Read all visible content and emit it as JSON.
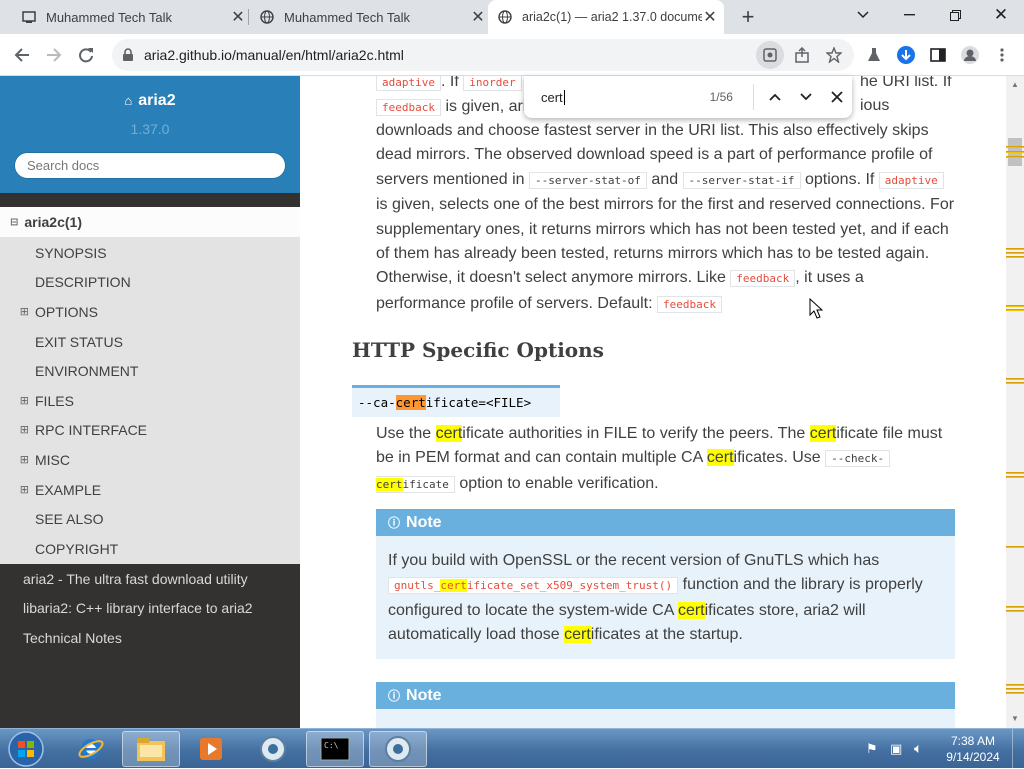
{
  "browser": {
    "tabs": [
      {
        "title": "Muhammed Tech Talk",
        "active": false
      },
      {
        "title": "Muhammed Tech Talk",
        "active": false
      },
      {
        "title": "aria2c(1) — aria2 1.37.0 docume",
        "active": true
      }
    ],
    "new_tab_icon": "plus-icon",
    "url": "aria2.github.io/manual/en/html/aria2c.html"
  },
  "find": {
    "query": "cert",
    "count": "1/56"
  },
  "sidebar": {
    "project": "aria2",
    "version": "1.37.0",
    "search_placeholder": "Search docs",
    "toc_root": "aria2c(1)",
    "items": [
      {
        "label": "SYNOPSIS",
        "toggle": false
      },
      {
        "label": "DESCRIPTION",
        "toggle": false
      },
      {
        "label": "OPTIONS",
        "toggle": true
      },
      {
        "label": "EXIT STATUS",
        "toggle": false
      },
      {
        "label": "ENVIRONMENT",
        "toggle": false
      },
      {
        "label": "FILES",
        "toggle": true
      },
      {
        "label": "RPC INTERFACE",
        "toggle": true
      },
      {
        "label": "MISC",
        "toggle": true
      },
      {
        "label": "EXAMPLE",
        "toggle": true
      },
      {
        "label": "SEE ALSO",
        "toggle": false
      },
      {
        "label": "COPYRIGHT",
        "toggle": false
      }
    ],
    "links": [
      "aria2 - The ultra fast download utility",
      "libaria2: C++ library interface to aria2",
      "Technical Notes"
    ]
  },
  "content": {
    "top_frag": {
      "code_adaptive": "adaptive",
      "t_if": ". If",
      "code_inorder": "inorder",
      "t_tail": "he URI list. If",
      "code_feedback": "feedback",
      "t_given": "is given, ari",
      "t_ious": "ious"
    },
    "para1": {
      "l3": "downloads and choose fastest server in the URI list. This also effectively skips",
      "l4": "dead mirrors. The observed download speed is a part of performance profile of",
      "l5a": "servers mentioned in",
      "code_statof": "--server-stat-of",
      "l5b": "and",
      "code_statif": "--server-stat-if",
      "l5c": "options. If",
      "code_adaptive": "adaptive",
      "l6": "is given, selects one of the best mirrors for the first and reserved connections. For",
      "l7": "supplementary ones, it returns mirrors which has not been tested yet, and if each",
      "l8": "of them has already been tested, returns mirrors which has to be tested again.",
      "l9a": "Otherwise, it doesn't select anymore mirrors. Like",
      "code_feedback": "feedback",
      "l9b": ", it uses a",
      "l10a": "performance profile of servers. Default:",
      "code_default": "feedback"
    },
    "section_title": "HTTP Specific Options",
    "option": {
      "pre": "--ca-",
      "match": "cert",
      "post": "ificate=<FILE>"
    },
    "para2": {
      "a1": "Use the",
      "m1": "cert",
      "a2": "ificate authorities in FILE to verify the peers. The",
      "m2": "cert",
      "a3": "ificate file must",
      "b1": "be in PEM format and can contain multiple CA",
      "m3": "cert",
      "b2": "ificates. Use",
      "code_check": "--check-",
      "c_m": "cert",
      "c_code": "ificate",
      "c_tail": "option to enable verification."
    },
    "note1": {
      "title": "Note",
      "l1": "If you build with OpenSSL or the recent version of GnuTLS which has",
      "code_pre": "gnutls_",
      "code_m": "cert",
      "code_post": "ificate_set_x509_system_trust()",
      "l2b": "function and the library is properly",
      "l3a": "configured to locate the system-wide CA",
      "l3m": "cert",
      "l3b": "ificates store, aria2 will",
      "l4a": "automatically load those",
      "l4m": "cert",
      "l4b": "ificates at the startup."
    },
    "note2": {
      "title": "Note"
    }
  },
  "taskbar": {
    "time": "7:38 AM",
    "date": "9/14/2024"
  },
  "colors": {
    "sidebar_header": "#2980b9",
    "highlight": "#ffff00",
    "current_match": "#ff9632"
  }
}
